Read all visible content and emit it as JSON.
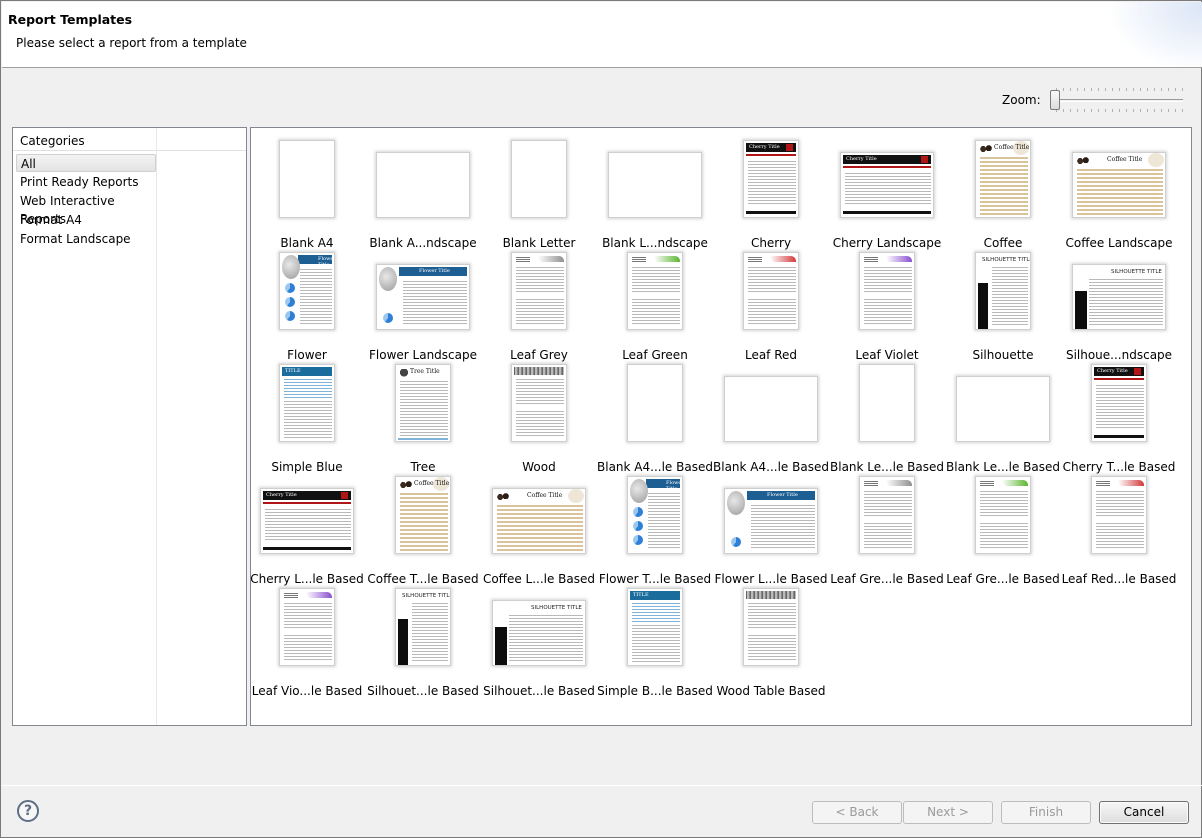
{
  "header": {
    "title": "Report Templates",
    "subtitle": "Please select a report from a template"
  },
  "zoom": {
    "label": "Zoom:",
    "level": 0
  },
  "categories": {
    "header": "Categories",
    "items": [
      "All",
      "Print Ready Reports",
      "Web Interactive Reports",
      "Format A4",
      "Format Landscape"
    ],
    "selected": "All"
  },
  "templates": [
    "Blank A4",
    "Blank A...ndscape",
    "Blank Letter",
    "Blank L...ndscape",
    "Cherry",
    "Cherry Landscape",
    "Coffee",
    "Coffee Landscape",
    "Flower",
    "Flower Landscape",
    "Leaf Grey",
    "Leaf Green",
    "Leaf Red",
    "Leaf Violet",
    "Silhouette",
    "Silhoue...ndscape",
    "Simple Blue",
    "Tree",
    "Wood",
    "Blank A4...le Based",
    "Blank A4...le Based",
    "Blank Le...le Based",
    "Blank Le...le Based",
    "Cherry T...le Based",
    "Cherry L...le Based",
    "Coffee T...le Based",
    "Coffee L...le Based",
    "Flower T...le Based",
    "Flower L...le Based",
    "Leaf Gre...le Based",
    "Leaf Gre...le Based",
    "Leaf Red...le Based",
    "Leaf Vio...le Based",
    "Silhouet...le Based",
    "Silhouet...le Based",
    "Simple B...le Based",
    "Wood Table Based"
  ],
  "thumb_text": {
    "cherry": "Cherry Title",
    "coffee": "Coffee Title",
    "flower": "Flower Title",
    "silhouette": "SILHOUETTE TITLE",
    "tree": "Tree Title",
    "simple": "TITLE"
  },
  "buttons": {
    "back": "< Back",
    "next": "Next >",
    "finish": "Finish",
    "cancel": "Cancel"
  },
  "icons": {
    "help": "help-icon"
  },
  "colors": {
    "cherry_red": "#b01616",
    "simple_blue": "#1a6c9c",
    "leaf_green": "#5ab52e",
    "leaf_red": "#d33a3a",
    "leaf_violet": "#8a4fd0",
    "leaf_grey": "#8f8f8f"
  }
}
